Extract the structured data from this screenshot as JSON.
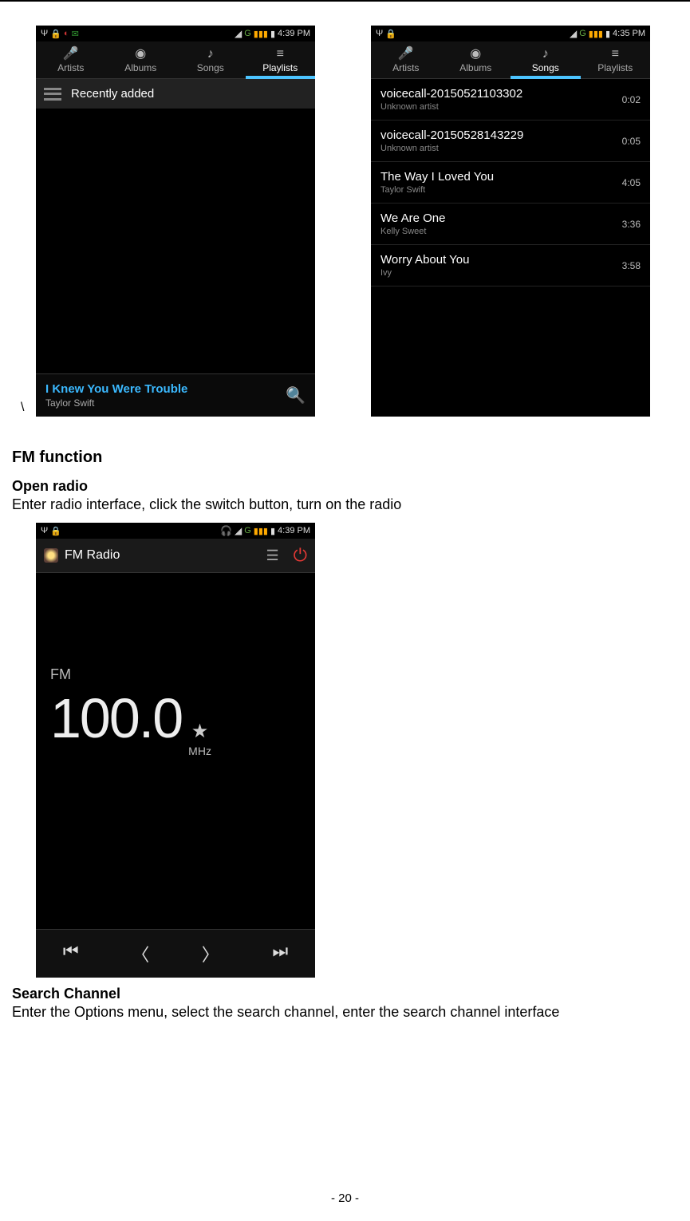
{
  "statusbar1": {
    "time": "4:39 PM",
    "net": "G"
  },
  "statusbar2": {
    "time": "4:35 PM",
    "net": "G"
  },
  "statusbar3": {
    "time": "4:39 PM",
    "net": "G"
  },
  "tabs": {
    "artists": "Artists",
    "albums": "Albums",
    "songs": "Songs",
    "playlists": "Playlists"
  },
  "screen1": {
    "recent": "Recently added",
    "np_title": "I Knew You Were Trouble",
    "np_artist": "Taylor Swift"
  },
  "screen2": {
    "songs": [
      {
        "title": "voicecall-20150521103302",
        "artist": "Unknown artist",
        "dur": "0:02"
      },
      {
        "title": "voicecall-20150528143229",
        "artist": "Unknown artist",
        "dur": "0:05"
      },
      {
        "title": "The Way I Loved You",
        "artist": "Taylor Swift",
        "dur": "4:05"
      },
      {
        "title": "We Are One",
        "artist": "Kelly Sweet",
        "dur": "3:36"
      },
      {
        "title": "Worry About You",
        "artist": "Ivy",
        "dur": "3:58"
      }
    ]
  },
  "doc": {
    "backslash": "\\",
    "h1": "FM function",
    "h2a": "Open radio",
    "p1": "Enter radio interface, click the switch button, turn on the radio",
    "h2b": "Search Channel",
    "p2": "Enter the Options menu, select the search channel, enter the search channel interface",
    "footer": "- 20 -"
  },
  "fm": {
    "title": "FM Radio",
    "label": "FM",
    "freq": "100.0",
    "unit": "MHz"
  }
}
